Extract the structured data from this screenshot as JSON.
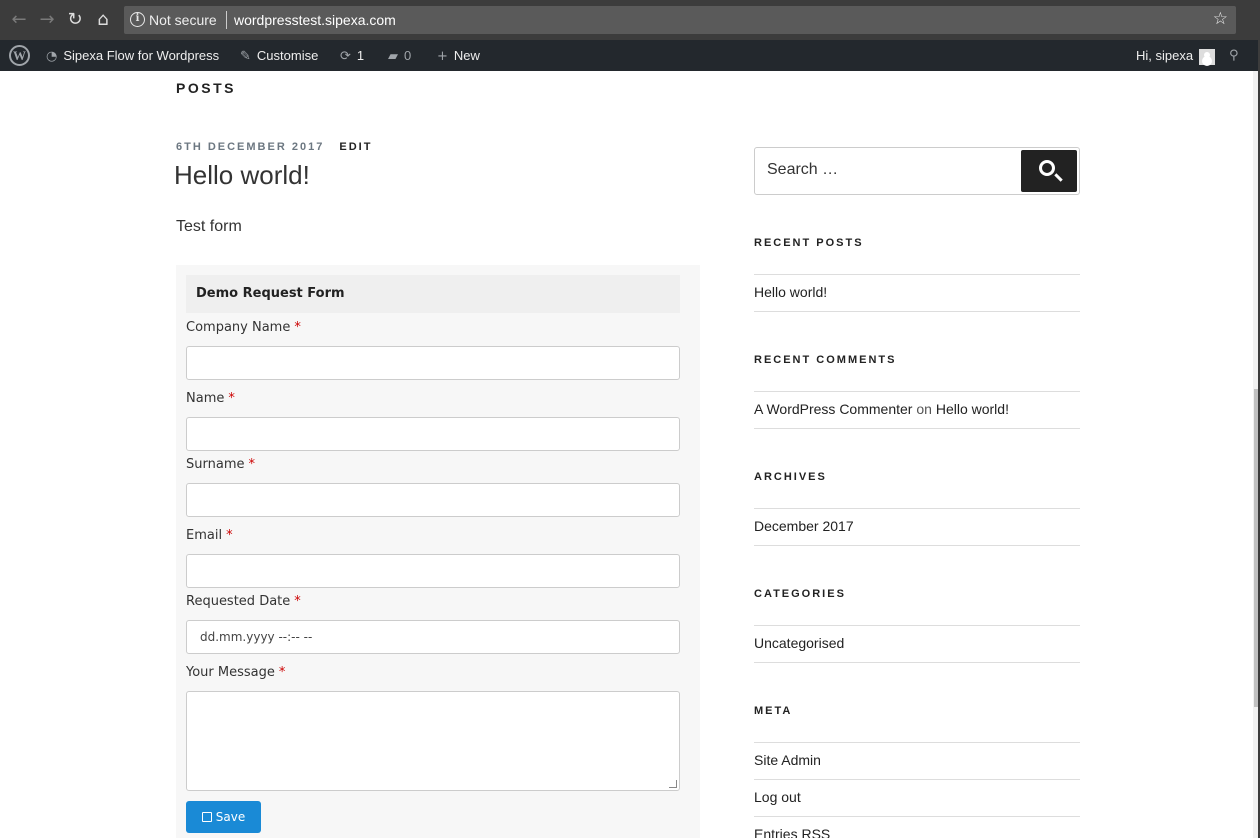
{
  "browser": {
    "security_label": "Not secure",
    "url": "wordpresstest.sipexa.com"
  },
  "adminbar": {
    "site_name": "Sipexa Flow for Wordpress",
    "customise": "Customise",
    "updates_count": "1",
    "comments_count": "0",
    "new_label": "New",
    "greeting": "Hi, sipexa"
  },
  "page": {
    "section_heading": "POSTS",
    "post": {
      "date": "6TH DECEMBER 2017",
      "edit": "EDIT",
      "title": "Hello world!",
      "excerpt": "Test form"
    }
  },
  "form": {
    "title": "Demo Request Form",
    "required_marker": "*",
    "fields": [
      {
        "label": "Company Name",
        "value": ""
      },
      {
        "label": "Name",
        "value": ""
      },
      {
        "label": "Surname",
        "value": ""
      },
      {
        "label": "Email",
        "value": ""
      },
      {
        "label": "Requested Date",
        "value": "dd.mm.yyyy  --:-- --"
      },
      {
        "label": "Your Message",
        "value": ""
      }
    ],
    "save_label": "Save"
  },
  "sidebar": {
    "search_placeholder": "Search …",
    "recent_posts": {
      "title": "RECENT POSTS",
      "items": [
        "Hello world!"
      ]
    },
    "recent_comments": {
      "title": "RECENT COMMENTS",
      "author": "A WordPress Commenter",
      "on": "on",
      "post": "Hello world!"
    },
    "archives": {
      "title": "ARCHIVES",
      "items": [
        "December 2017"
      ]
    },
    "categories": {
      "title": "CATEGORIES",
      "items": [
        "Uncategorised"
      ]
    },
    "meta": {
      "title": "META",
      "items": [
        "Site Admin",
        "Log out",
        "Entries RSS"
      ]
    }
  }
}
